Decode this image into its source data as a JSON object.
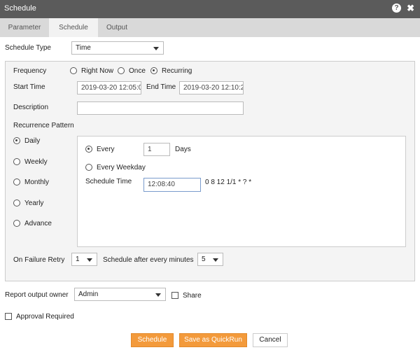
{
  "window": {
    "title": "Schedule",
    "help_icon": "?",
    "close_icon": "✖"
  },
  "tabs": [
    {
      "label": "Parameter",
      "active": false
    },
    {
      "label": "Schedule",
      "active": true
    },
    {
      "label": "Output",
      "active": false
    }
  ],
  "schedule_type": {
    "label": "Schedule Type",
    "value": "Time"
  },
  "frequency": {
    "label": "Frequency",
    "options": [
      "Right Now",
      "Once",
      "Recurring"
    ],
    "selected": "Recurring"
  },
  "start_time": {
    "label": "Start Time",
    "value": "2019-03-20 12:05:0"
  },
  "end_time": {
    "label": "End Time",
    "value": "2019-03-20 12:10:2"
  },
  "description": {
    "label": "Description",
    "value": ""
  },
  "recurrence": {
    "label": "Recurrence Pattern",
    "options": [
      "Daily",
      "Weekly",
      "Monthly",
      "Yearly",
      "Advance"
    ],
    "selected": "Daily"
  },
  "daily": {
    "every_label": "Every",
    "every_value": "1",
    "days_label": "Days",
    "weekday_label": "Every Weekday",
    "selected": "Every",
    "schedule_time_label": "Schedule Time",
    "schedule_time_value": "12:08:40",
    "cron": "0 8 12 1/1 * ? *"
  },
  "failure": {
    "label": "On Failure Retry",
    "retry_value": "1",
    "after_label": "Schedule after every minutes",
    "minutes_value": "5"
  },
  "owner": {
    "label": "Report output owner",
    "value": "Admin",
    "share_label": "Share"
  },
  "approval": {
    "label": "Approval Required"
  },
  "buttons": {
    "schedule": "Schedule",
    "quickrun": "Save as QuickRun",
    "cancel": "Cancel"
  }
}
